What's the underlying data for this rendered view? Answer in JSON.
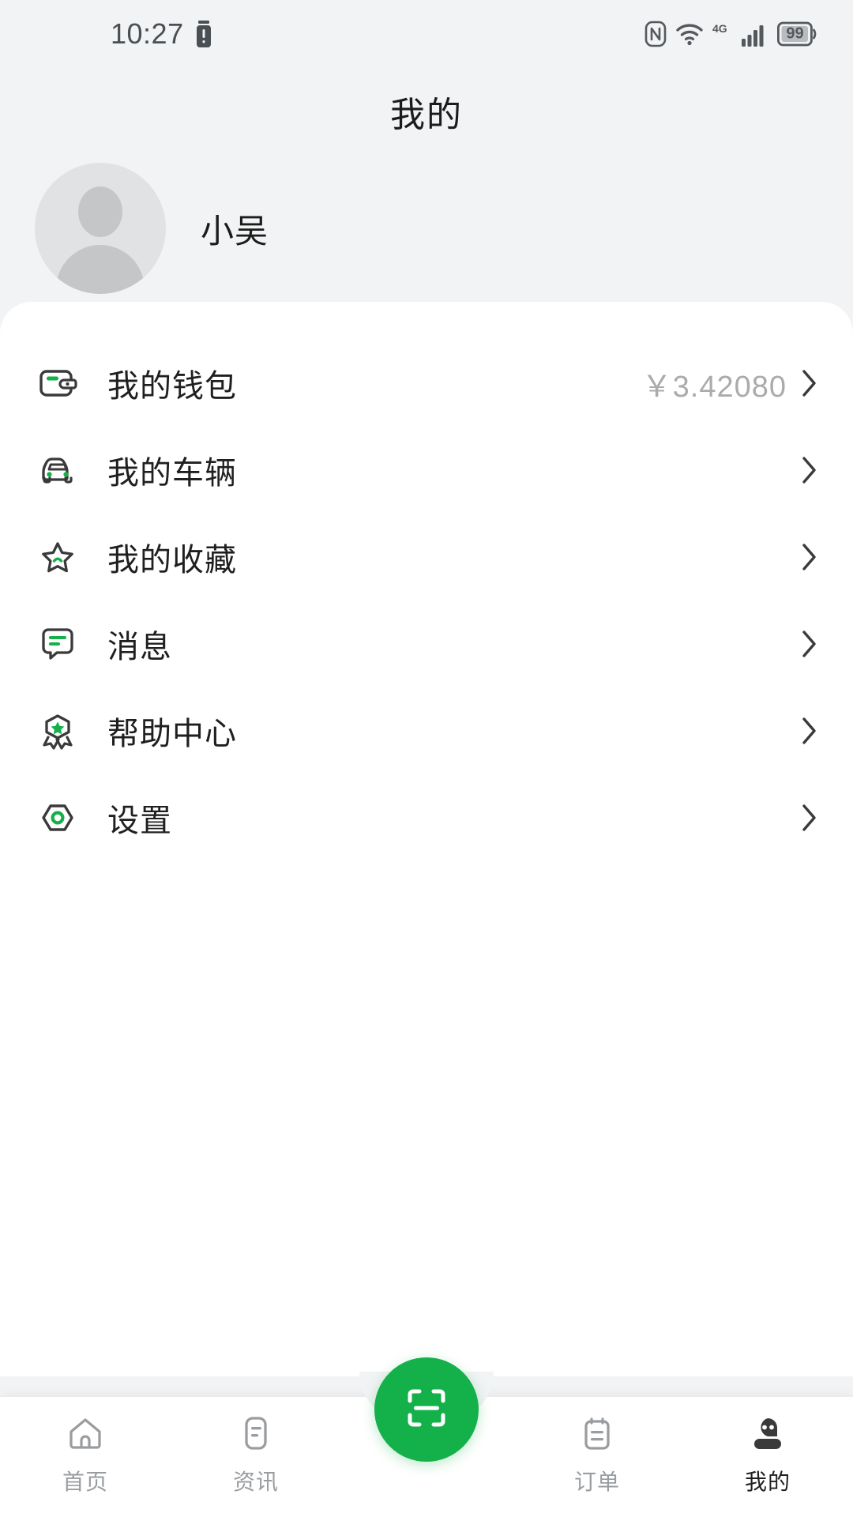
{
  "statusbar": {
    "time": "10:27",
    "battery_percent": "99",
    "network_type": "4G",
    "icons": [
      "alarm-battery-icon",
      "nfc-icon",
      "wifi-icon",
      "network-4g-icon",
      "signal-bars-icon",
      "battery-icon"
    ]
  },
  "header": {
    "title": "我的"
  },
  "profile": {
    "username": "小吴",
    "avatar": "default-avatar-icon"
  },
  "menu": {
    "items": [
      {
        "icon": "wallet-icon",
        "label": "我的钱包",
        "value": "￥3.42080"
      },
      {
        "icon": "car-icon",
        "label": "我的车辆",
        "value": ""
      },
      {
        "icon": "star-icon",
        "label": "我的收藏",
        "value": ""
      },
      {
        "icon": "message-icon",
        "label": "消息",
        "value": ""
      },
      {
        "icon": "badge-icon",
        "label": "帮助中心",
        "value": ""
      },
      {
        "icon": "settings-icon",
        "label": "设置",
        "value": ""
      }
    ]
  },
  "tabbar": {
    "items": [
      {
        "icon": "home-icon",
        "label": "首页",
        "active": false
      },
      {
        "icon": "news-icon",
        "label": "资讯",
        "active": false
      },
      {
        "icon": "orders-icon",
        "label": "订单",
        "active": false
      },
      {
        "icon": "profile-icon",
        "label": "我的",
        "active": true
      }
    ],
    "fab": {
      "icon": "scan-icon",
      "label": ""
    }
  },
  "colors": {
    "accent_green": "#14b04a",
    "icon_green": "#15b04b",
    "icon_dark": "#3a3a3a",
    "page_bg": "#f1f3f4",
    "card_bg": "#ffffff",
    "text_primary": "#1f1f1f",
    "text_muted": "#a9abad",
    "tab_inactive": "#9a9da0"
  }
}
